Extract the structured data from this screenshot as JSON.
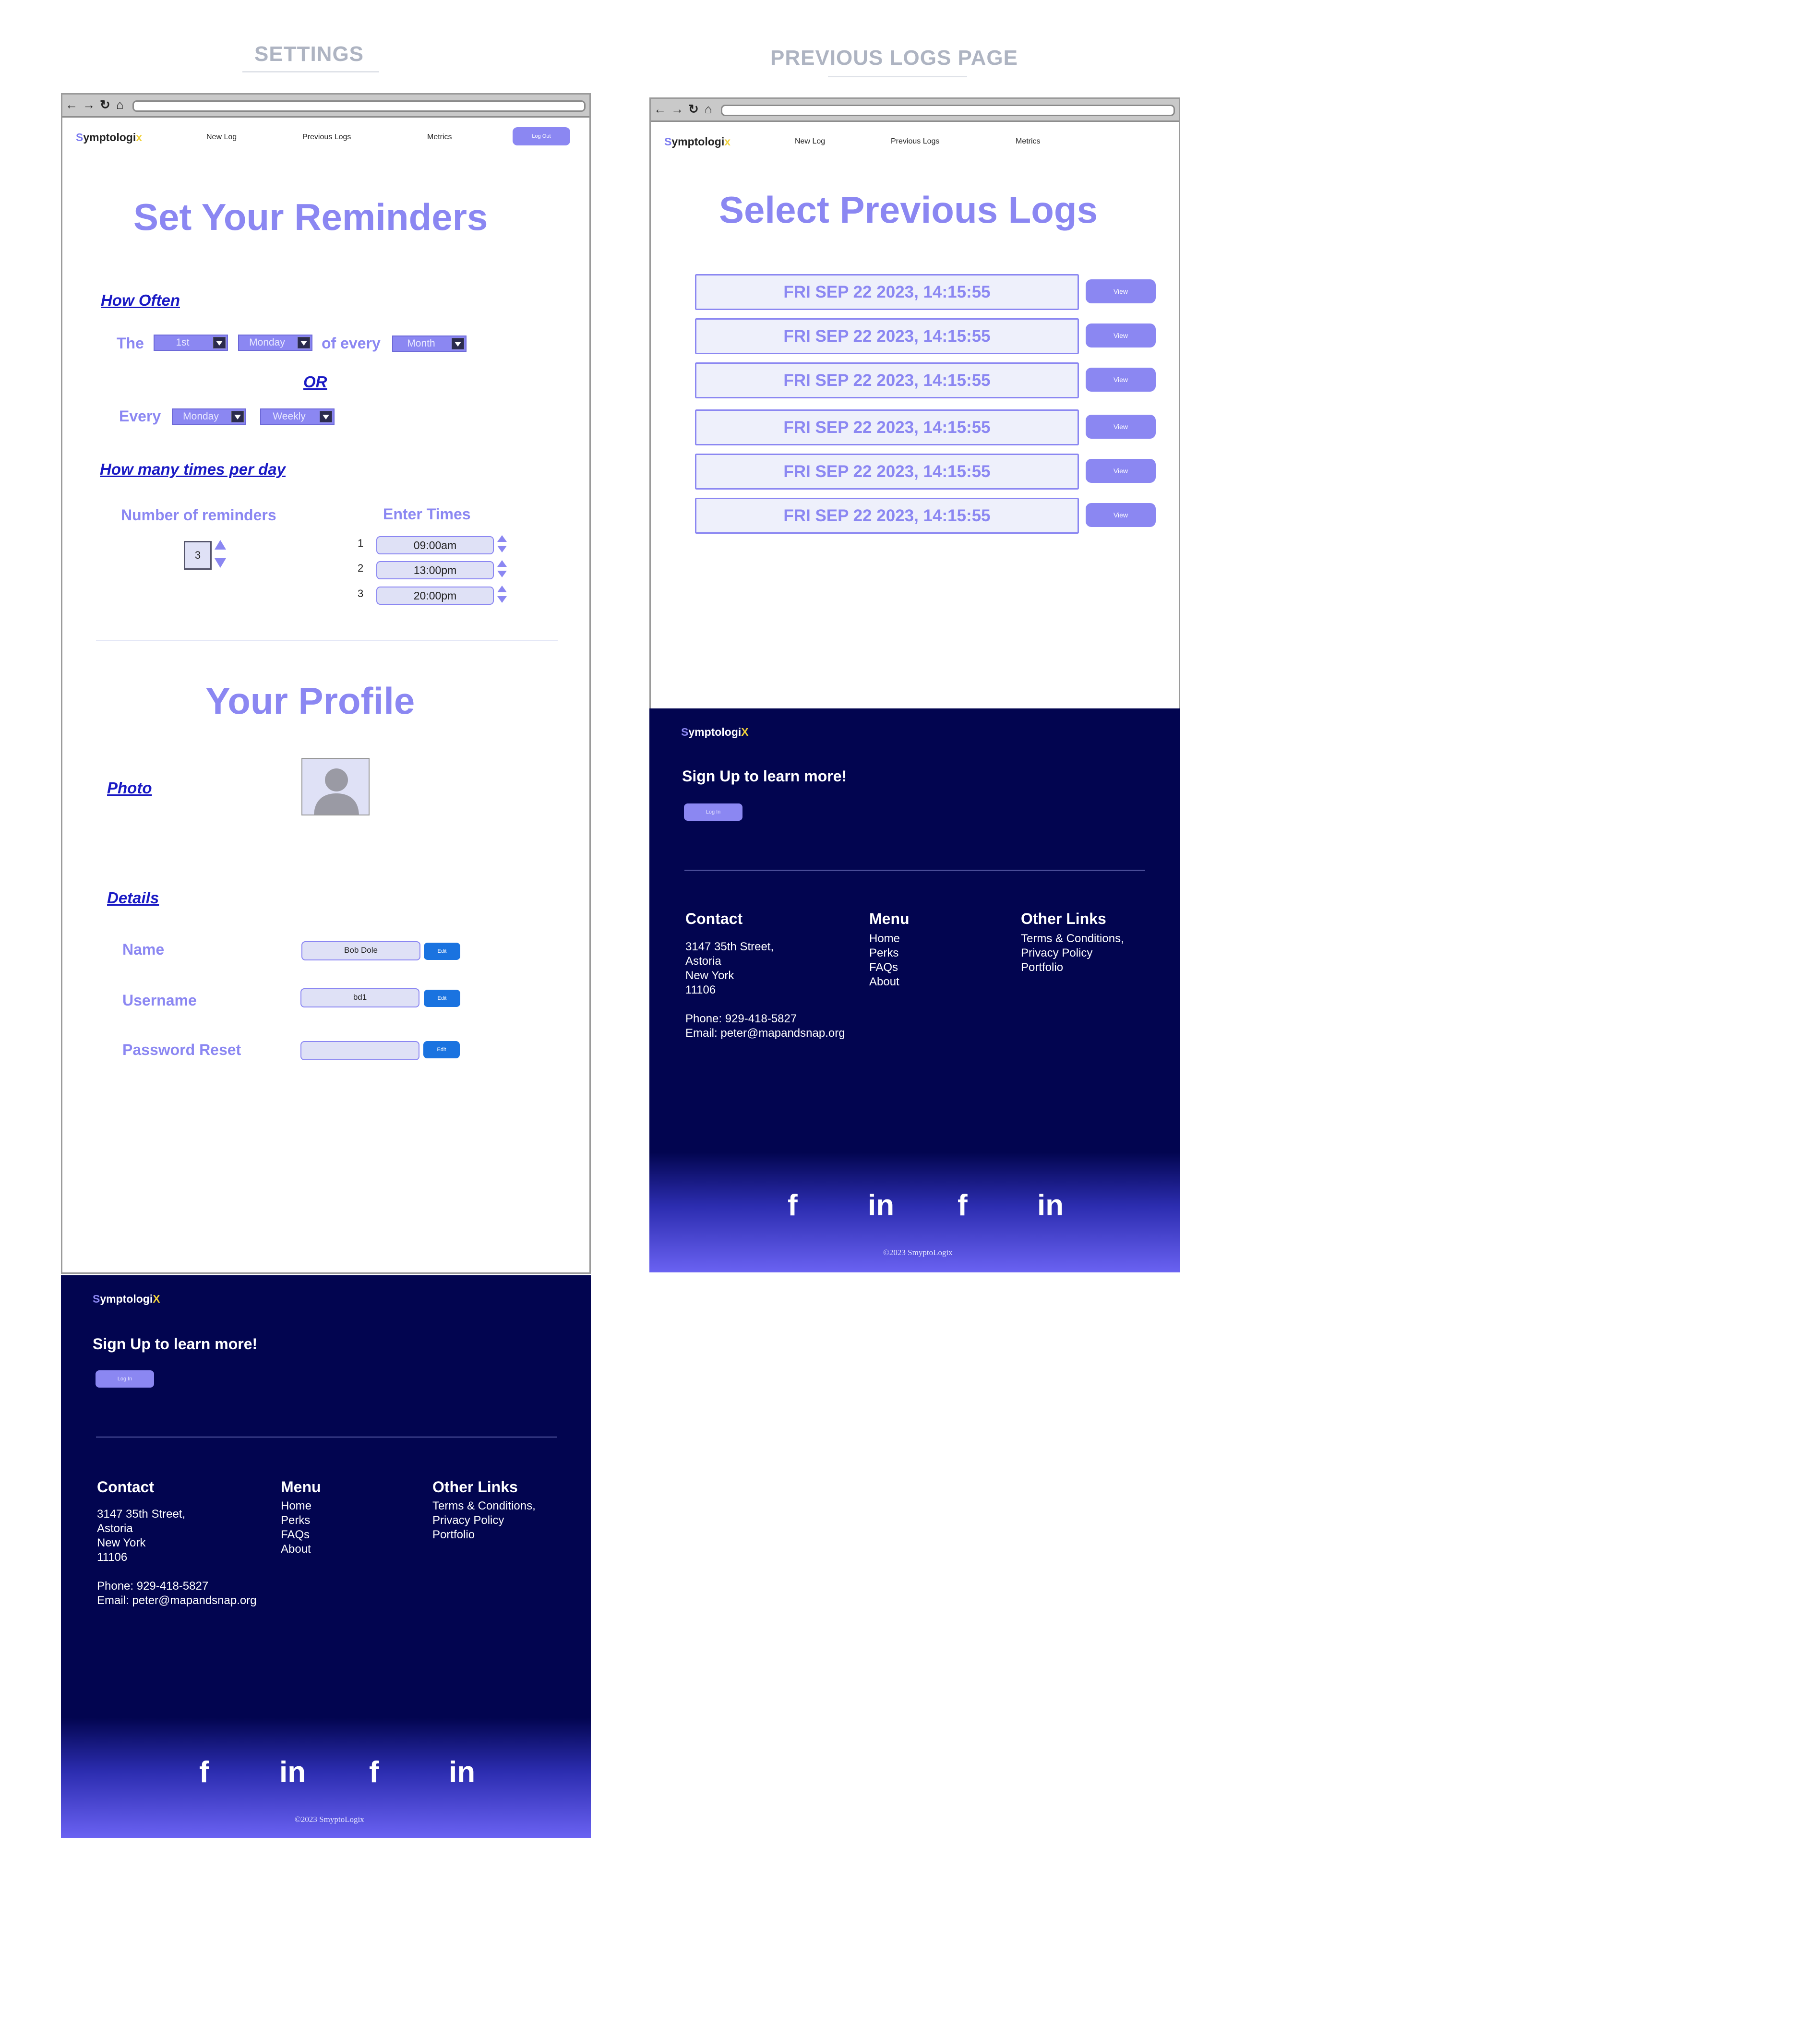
{
  "labels": {
    "settings": "SETTINGS",
    "previous_logs_page": "PREVIOUS LOGS PAGE"
  },
  "colors": {
    "accent": "#8b87f2",
    "link": "#1a1ac4",
    "footer_bg": "#020550",
    "edit_button": "#1a73e0",
    "logo_x": "#f1d23b"
  },
  "browser_icons": [
    "back-arrow-icon",
    "forward-arrow-icon",
    "reload-icon",
    "home-icon"
  ],
  "nav": {
    "logo_s": "S",
    "logo_mid": "ymptologi",
    "logo_x": "x",
    "links": [
      "New Log",
      "Previous Logs",
      "Metrics"
    ],
    "logout": "Log Out"
  },
  "settings": {
    "title": "Set Your Reminders",
    "how_often": "How Often",
    "the": "The",
    "day_ordinal": "1st",
    "weekday1": "Monday",
    "of_every": "of every",
    "period1": "Month",
    "or": "OR",
    "every": "Every",
    "weekday2": "Monday",
    "period2": "Weekly",
    "times_per_day": "How many times per day",
    "num_reminders_label": "Number of reminders",
    "num_reminders": "3",
    "enter_times": "Enter Times",
    "times": [
      {
        "n": "1",
        "t": "09:00am"
      },
      {
        "n": "2",
        "t": "13:00pm"
      },
      {
        "n": "3",
        "t": "20:00pm"
      }
    ],
    "profile_title": "Your Profile",
    "photo": "Photo",
    "details": "Details",
    "name_label": "Name",
    "name_value": "Bob Dole",
    "username_label": "Username",
    "username_value": "bd1",
    "password_label": "Password Reset",
    "password_value": "",
    "edit": "Edit"
  },
  "logs": {
    "title": "Select Previous Logs",
    "entries": [
      "FRI SEP 22 2023, 14:15:55",
      "FRI SEP 22 2023, 14:15:55",
      "FRI SEP 22 2023, 14:15:55",
      "FRI SEP 22 2023, 14:15:55",
      "FRI SEP 22 2023, 14:15:55",
      "FRI SEP 22 2023, 14:15:55"
    ],
    "view": "View"
  },
  "footer": {
    "logo_s": "S",
    "logo_mid": "ymptologi",
    "logo_x": "X",
    "signup": "Sign Up to learn more!",
    "login": "Log In",
    "contact_head": "Contact",
    "contact_lines": [
      "3147 35th Street,",
      "Astoria",
      "New York",
      "11106"
    ],
    "phone": "Phone: 929-418-5827",
    "email": "Email: peter@mapandsnap.org",
    "menu_head": "Menu",
    "menu_items": [
      "Home",
      "Perks",
      "FAQs",
      "About"
    ],
    "other_head": "Other Links",
    "other_items": [
      "Terms & Conditions,",
      "Privacy Policy",
      "Portfolio"
    ],
    "social": [
      "f",
      "in",
      "f",
      "in"
    ],
    "social_icons": [
      "facebook-icon",
      "linkedin-icon",
      "facebook-icon",
      "linkedin-icon"
    ],
    "copyright": "©2023 SmyptoLogix"
  }
}
